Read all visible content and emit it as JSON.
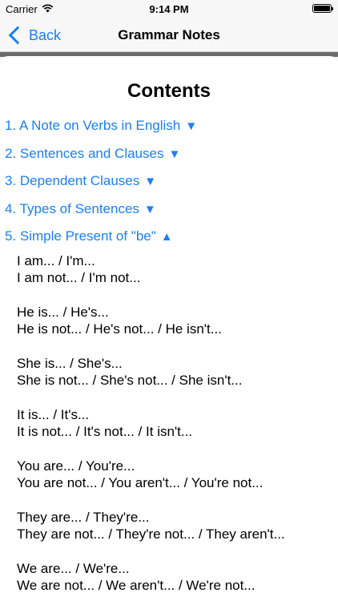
{
  "status": {
    "carrier": "Carrier",
    "time": "9:14 PM"
  },
  "nav": {
    "back_label": "Back",
    "title": "Grammar Notes"
  },
  "contents": {
    "title": "Contents",
    "items": [
      {
        "label": "1. A Note on Verbs in English",
        "arrow": "▼"
      },
      {
        "label": "2. Sentences and Clauses",
        "arrow": "▼"
      },
      {
        "label": "3. Dependent Clauses",
        "arrow": "▼"
      },
      {
        "label": "4. Types of Sentences",
        "arrow": "▼"
      },
      {
        "label": "5. Simple Present of \"be\"",
        "arrow": "▲"
      }
    ],
    "expanded": [
      {
        "line1": "I am... / I'm...",
        "line2": "I am not... / I'm not..."
      },
      {
        "line1": "He is... / He's...",
        "line2": "He is not... / He's not... / He isn't..."
      },
      {
        "line1": "She is... / She's...",
        "line2": "She is not... / She's not... / She isn't..."
      },
      {
        "line1": "It is... / It's...",
        "line2": "It is not... / It's not... / It isn't..."
      },
      {
        "line1": "You are... / You're...",
        "line2": "You are not... / You aren't... / You're not..."
      },
      {
        "line1": "They are... / They're...",
        "line2": "They are not... / They're not... / They aren't..."
      },
      {
        "line1": "We are... / We're...",
        "line2": "We are not... / We aren't... / We're not..."
      }
    ]
  },
  "colors": {
    "accent": "#1a7ff6",
    "divider": "#6b6b6b"
  },
  "icons": {
    "wifi": "wifi-icon",
    "battery": "battery-icon",
    "back": "chevron-left-icon"
  }
}
